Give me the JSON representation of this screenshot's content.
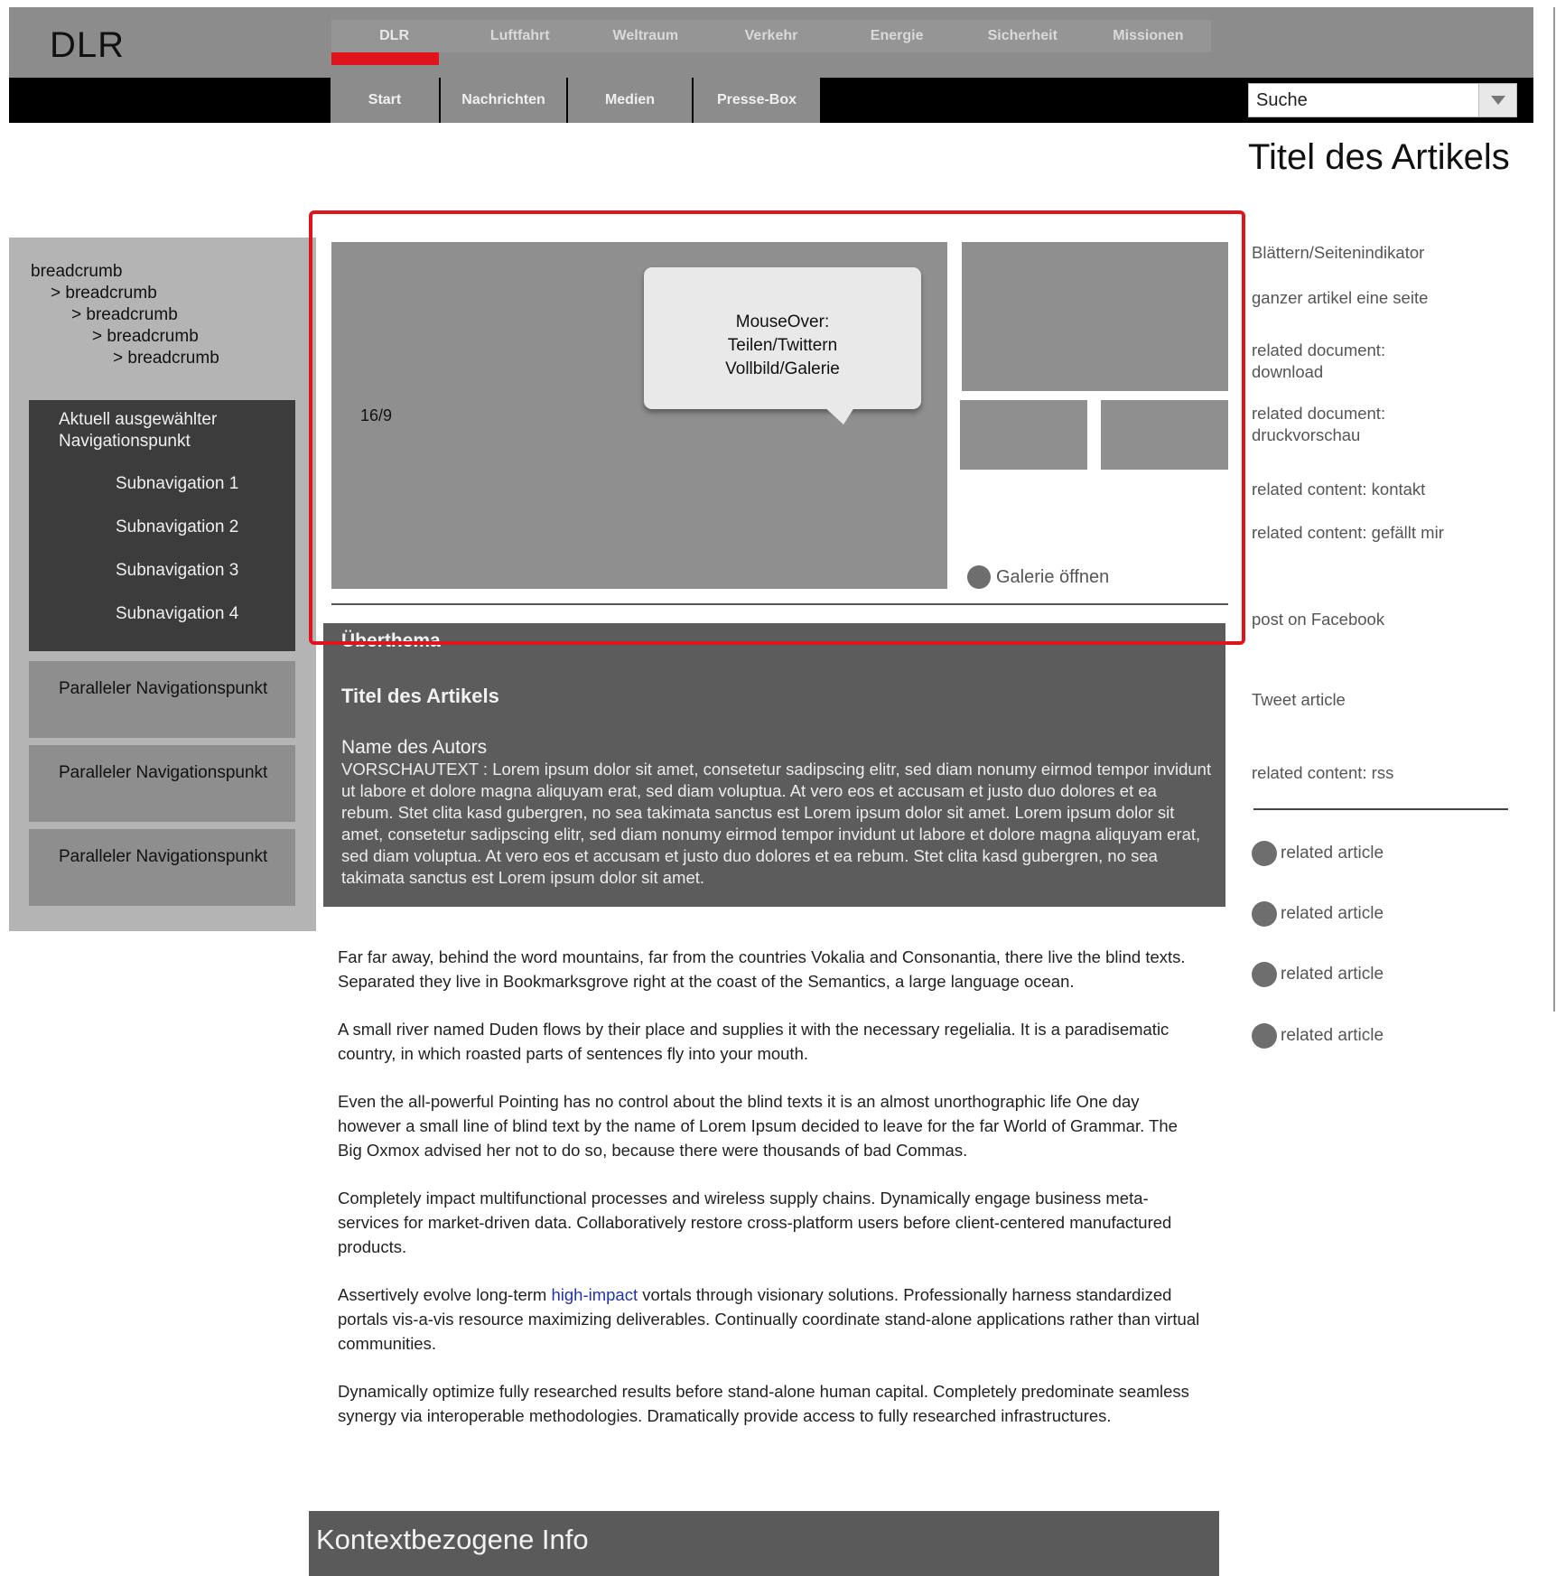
{
  "header": {
    "logo": "DLR",
    "main_nav": [
      "DLR",
      "Luftfahrt",
      "Weltraum",
      "Verkehr",
      "Energie",
      "Sicherheit",
      "Missionen"
    ],
    "sub_nav": [
      "Start",
      "Nachrichten",
      "Medien",
      "Presse-Box"
    ],
    "search_value": "Suche"
  },
  "article_title": "Titel des Artikels",
  "sidebar": {
    "breadcrumbs": [
      "breadcrumb",
      "> breadcrumb",
      "> breadcrumb",
      "> breadcrumb",
      "> breadcrumb"
    ],
    "current_item": "Aktuell ausgewählter Navigationspunkt",
    "sub_items": [
      "Subnavigation 1",
      "Subnavigation 2",
      "Subnavigation 3",
      "Subnavigation 4"
    ],
    "parallel_items": [
      "Paralleler Navigationspunkt",
      "Paralleler Navigationspunkt",
      "Paralleler Navigationspunkt"
    ]
  },
  "media": {
    "ratio_label": "16/9",
    "tooltip": [
      "MouseOver:",
      "Teilen/Twittern",
      "Vollbild/Galerie"
    ],
    "gallery_link": "Galerie öffnen"
  },
  "teaser": {
    "overtheme": "Überthema",
    "title": "Titel des Artikels",
    "author": "Name des Autors",
    "lead": "VORSCHAUTEXT : Lorem ipsum dolor sit amet, consetetur sadipscing elitr, sed diam nonumy eirmod tempor invidunt ut labore et dolore magna aliquyam erat, sed diam voluptua. At vero eos et accusam et justo duo dolores et ea rebum. Stet clita kasd gubergren, no sea takimata sanctus est Lorem ipsum dolor sit amet. Lorem ipsum dolor sit amet, consetetur sadipscing elitr, sed diam nonumy eirmod tempor invidunt ut labore et dolore magna aliquyam erat, sed diam voluptua. At vero eos et accusam et justo duo dolores et ea rebum. Stet clita kasd gubergren, no sea takimata sanctus est Lorem ipsum dolor sit amet."
  },
  "body": {
    "p1": "Far far away, behind the word mountains, far from the countries Vokalia and Consonantia, there live the blind texts. Separated they live in Bookmarksgrove right at the coast of the Semantics, a large language ocean.",
    "p2": "A small river named Duden flows by their place and supplies it with the necessary regelialia. It is a paradisematic country, in which roasted parts of sentences fly into your mouth.",
    "p3": "Even the all-powerful Pointing has no control about the blind texts it is an almost unorthographic life One day however a small line of blind text by the name of Lorem Ipsum decided to leave for the far World of Grammar. The Big Oxmox advised her not to do so, because there were thousands of bad Commas.",
    "p4": "Completely impact multifunctional processes and wireless supply chains. Dynamically engage business meta-services for market-driven data. Collaboratively restore cross-platform users before client-centered manufactured products.",
    "p5_before": "Assertively evolve long-term ",
    "p5_link": "high-impact",
    "p5_after": " vortals through visionary solutions. Professionally harness standardized portals vis-a-vis resource maximizing deliverables. Continually coordinate stand-alone applications rather than virtual communities.",
    "p6": "Dynamically optimize fully researched results before stand-alone human capital. Completely predominate seamless synergy via interoperable methodologies. Dramatically provide access to fully researched infrastructures."
  },
  "context_box": "Kontextbezogene Info",
  "right_column": {
    "pager": "Blättern/Seitenindikator",
    "one_page": "ganzer artikel eine seite",
    "doc_download": "related document: download",
    "doc_print": "related document: druckvorschau",
    "contact": "related content: kontakt",
    "like": "related content: gefällt mir",
    "facebook": "post on Facebook",
    "tweet": "Tweet article",
    "rss": "related content: rss",
    "related": [
      "related article",
      "related article",
      "related article",
      "related article"
    ]
  }
}
